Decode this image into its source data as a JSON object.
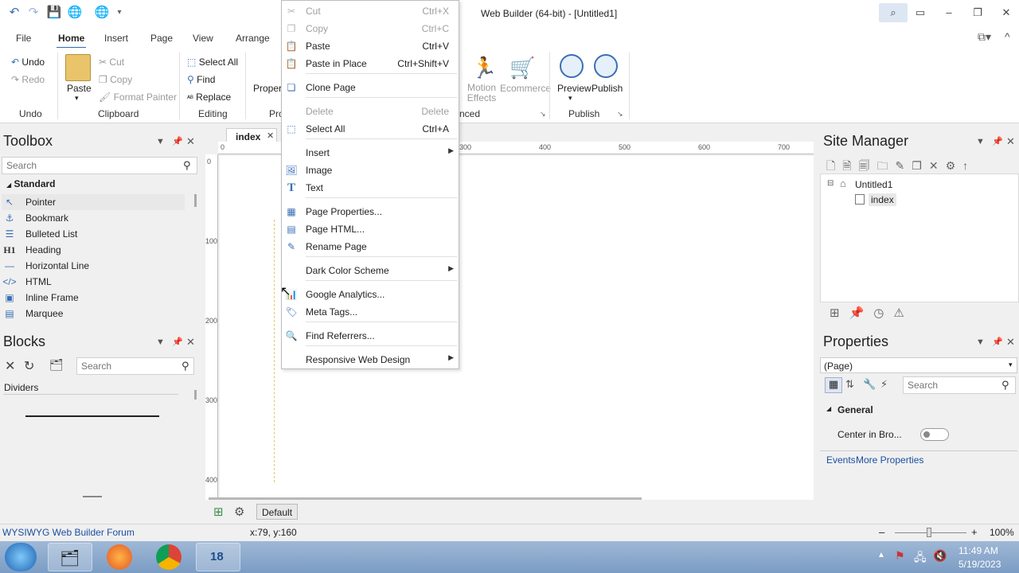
{
  "window": {
    "title": "Web Builder (64-bit) - [Untitled1]"
  },
  "ribbon_tabs": [
    "File",
    "Home",
    "Insert",
    "Page",
    "View",
    "Arrange"
  ],
  "ribbon": {
    "undo": "Undo",
    "redo": "Redo",
    "undo_group": "Undo",
    "paste": "Paste",
    "cut": "Cut",
    "copy": "Copy",
    "format_painter": "Format Painter",
    "clipboard_group": "Clipboard",
    "select_all": "Select All",
    "find": "Find",
    "replace": "Replace",
    "editing_group": "Editing",
    "properties_partial": "Proper",
    "properties_group_partial": "Pro",
    "motion_effects": "Motion Effects",
    "ecommerce": "Ecommerce",
    "advanced_group_partial": "nced",
    "preview": "Preview",
    "publish": "Publish",
    "publish_group": "Publish"
  },
  "toolbox": {
    "title": "Toolbox",
    "search_placeholder": "Search",
    "category": "Standard",
    "items": [
      {
        "label": "Pointer",
        "icon": "pointer-icon",
        "glyph": "↖"
      },
      {
        "label": "Bookmark",
        "icon": "anchor-icon",
        "glyph": "⚓"
      },
      {
        "label": "Bulleted List",
        "icon": "list-icon",
        "glyph": "☰"
      },
      {
        "label": "Heading",
        "icon": "heading-icon",
        "glyph": "H1"
      },
      {
        "label": "Horizontal Line",
        "icon": "line-icon",
        "glyph": "—"
      },
      {
        "label": "HTML",
        "icon": "code-icon",
        "glyph": "</>"
      },
      {
        "label": "Inline Frame",
        "icon": "frame-icon",
        "glyph": "▣"
      },
      {
        "label": "Marquee",
        "icon": "marquee-icon",
        "glyph": "▤"
      }
    ]
  },
  "blocks": {
    "title": "Blocks",
    "search_placeholder": "Search",
    "category": "Dividers"
  },
  "document": {
    "tab": "index",
    "ruler_h": [
      "0",
      "300",
      "400",
      "500",
      "600",
      "700"
    ],
    "ruler_v": [
      "0",
      "100",
      "200",
      "300",
      "400"
    ],
    "footer_button": "Default"
  },
  "context_menu": {
    "items": [
      {
        "label": "Cut",
        "shortcut": "Ctrl+X",
        "disabled": true,
        "icon": "cut-icon",
        "glyph": "✂"
      },
      {
        "label": "Copy",
        "shortcut": "Ctrl+C",
        "disabled": true,
        "icon": "copy-icon",
        "glyph": "❐"
      },
      {
        "label": "Paste",
        "shortcut": "Ctrl+V",
        "disabled": false,
        "icon": "paste-icon",
        "glyph": "📋"
      },
      {
        "label": "Paste in Place",
        "shortcut": "Ctrl+Shift+V",
        "disabled": false,
        "icon": "paste-in-place-icon",
        "glyph": "📋"
      },
      {
        "label": "Clone Page",
        "shortcut": "",
        "disabled": false,
        "icon": "clone-page-icon",
        "glyph": "❏"
      },
      {
        "label": "Delete",
        "shortcut": "Delete",
        "disabled": true,
        "icon": "",
        "glyph": ""
      },
      {
        "label": "Select All",
        "shortcut": "Ctrl+A",
        "disabled": false,
        "icon": "select-all-icon",
        "glyph": "⬚"
      },
      {
        "label": "Insert",
        "shortcut": "",
        "disabled": false,
        "submenu": true,
        "icon": "",
        "glyph": ""
      },
      {
        "label": "Image",
        "shortcut": "",
        "disabled": false,
        "icon": "image-icon",
        "glyph": "🖼"
      },
      {
        "label": "Text",
        "shortcut": "",
        "disabled": false,
        "icon": "text-icon",
        "glyph": "T"
      },
      {
        "label": "Page Properties...",
        "shortcut": "",
        "disabled": false,
        "icon": "page-properties-icon",
        "glyph": "▦"
      },
      {
        "label": "Page HTML...",
        "shortcut": "",
        "disabled": false,
        "icon": "page-html-icon",
        "glyph": "▤"
      },
      {
        "label": "Rename Page",
        "shortcut": "",
        "disabled": false,
        "icon": "rename-page-icon",
        "glyph": "✎"
      },
      {
        "label": "Dark Color Scheme",
        "shortcut": "",
        "disabled": false,
        "submenu": true,
        "icon": "",
        "glyph": ""
      },
      {
        "label": "Google Analytics...",
        "shortcut": "",
        "disabled": false,
        "icon": "analytics-icon",
        "glyph": "📊"
      },
      {
        "label": "Meta Tags...",
        "shortcut": "",
        "disabled": false,
        "icon": "meta-tags-icon",
        "glyph": "🏷"
      },
      {
        "label": "Find Referrers...",
        "shortcut": "",
        "disabled": false,
        "icon": "find-icon",
        "glyph": "🔍"
      },
      {
        "label": "Responsive Web Design",
        "shortcut": "",
        "disabled": false,
        "submenu": true,
        "icon": "",
        "glyph": ""
      }
    ]
  },
  "site_manager": {
    "title": "Site Manager",
    "root": "Untitled1",
    "page": "index"
  },
  "properties": {
    "title": "Properties",
    "selector": "(Page)",
    "search_placeholder": "Search",
    "section": "General",
    "row_label": "Center in Bro...",
    "events_link": "Events",
    "more_link": "More Properties"
  },
  "status": {
    "forum_link": "WYSIWYG Web Builder Forum",
    "coords": "x:79, y:160",
    "zoom": "100%"
  },
  "taskbar": {
    "time": "11:49 AM",
    "date": "5/19/2023",
    "app_badge": "18"
  }
}
